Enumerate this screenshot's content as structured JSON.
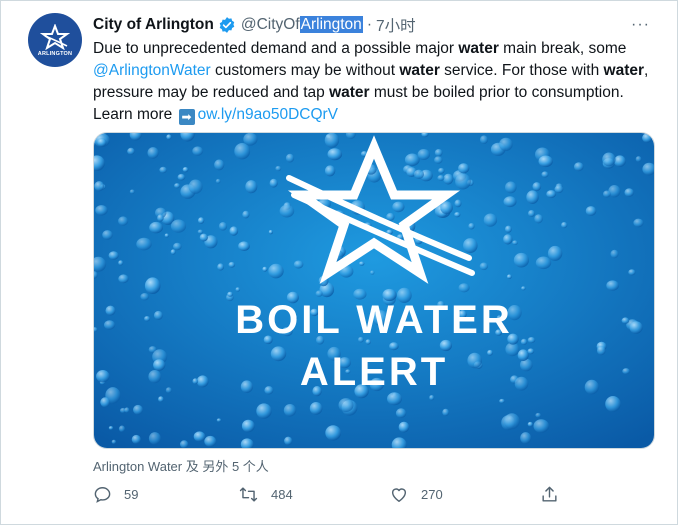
{
  "tweet": {
    "display_name": "City of Arlington",
    "handle_prefix": "@CityOf",
    "handle_highlight": "Arlington",
    "separator": "·",
    "time": "7小时",
    "more_label": "···",
    "text": {
      "p1": "Due to unprecedented demand and a possible major ",
      "b1": "water",
      "p2": " main break, some ",
      "mention": "@ArlingtonWater",
      "p3": " customers may be without ",
      "b2": "water",
      "p4": " service. For those with ",
      "b3": "water",
      "p5": ", pressure may be reduced and tap ",
      "b4": "water",
      "p6": " must be boiled prior to consumption. Learn more ",
      "arrow": "➡",
      "url": "ow.ly/n9ao50DCQrV"
    },
    "media": {
      "line1": "BOIL WATER",
      "line2": "ALERT",
      "bg_top": "#1a8fd8",
      "bg_bottom": "#0a5aa6"
    },
    "avatar_text": "ARLINGTON",
    "tagged": "Arlington Water 及 另外 5 个人",
    "actions": {
      "replies": "59",
      "retweets": "484",
      "likes": "270"
    },
    "colors": {
      "link": "#1d9bf0",
      "verified": "#1d9bf0",
      "secondary": "#536471",
      "brand": "#1f4f9c"
    }
  }
}
